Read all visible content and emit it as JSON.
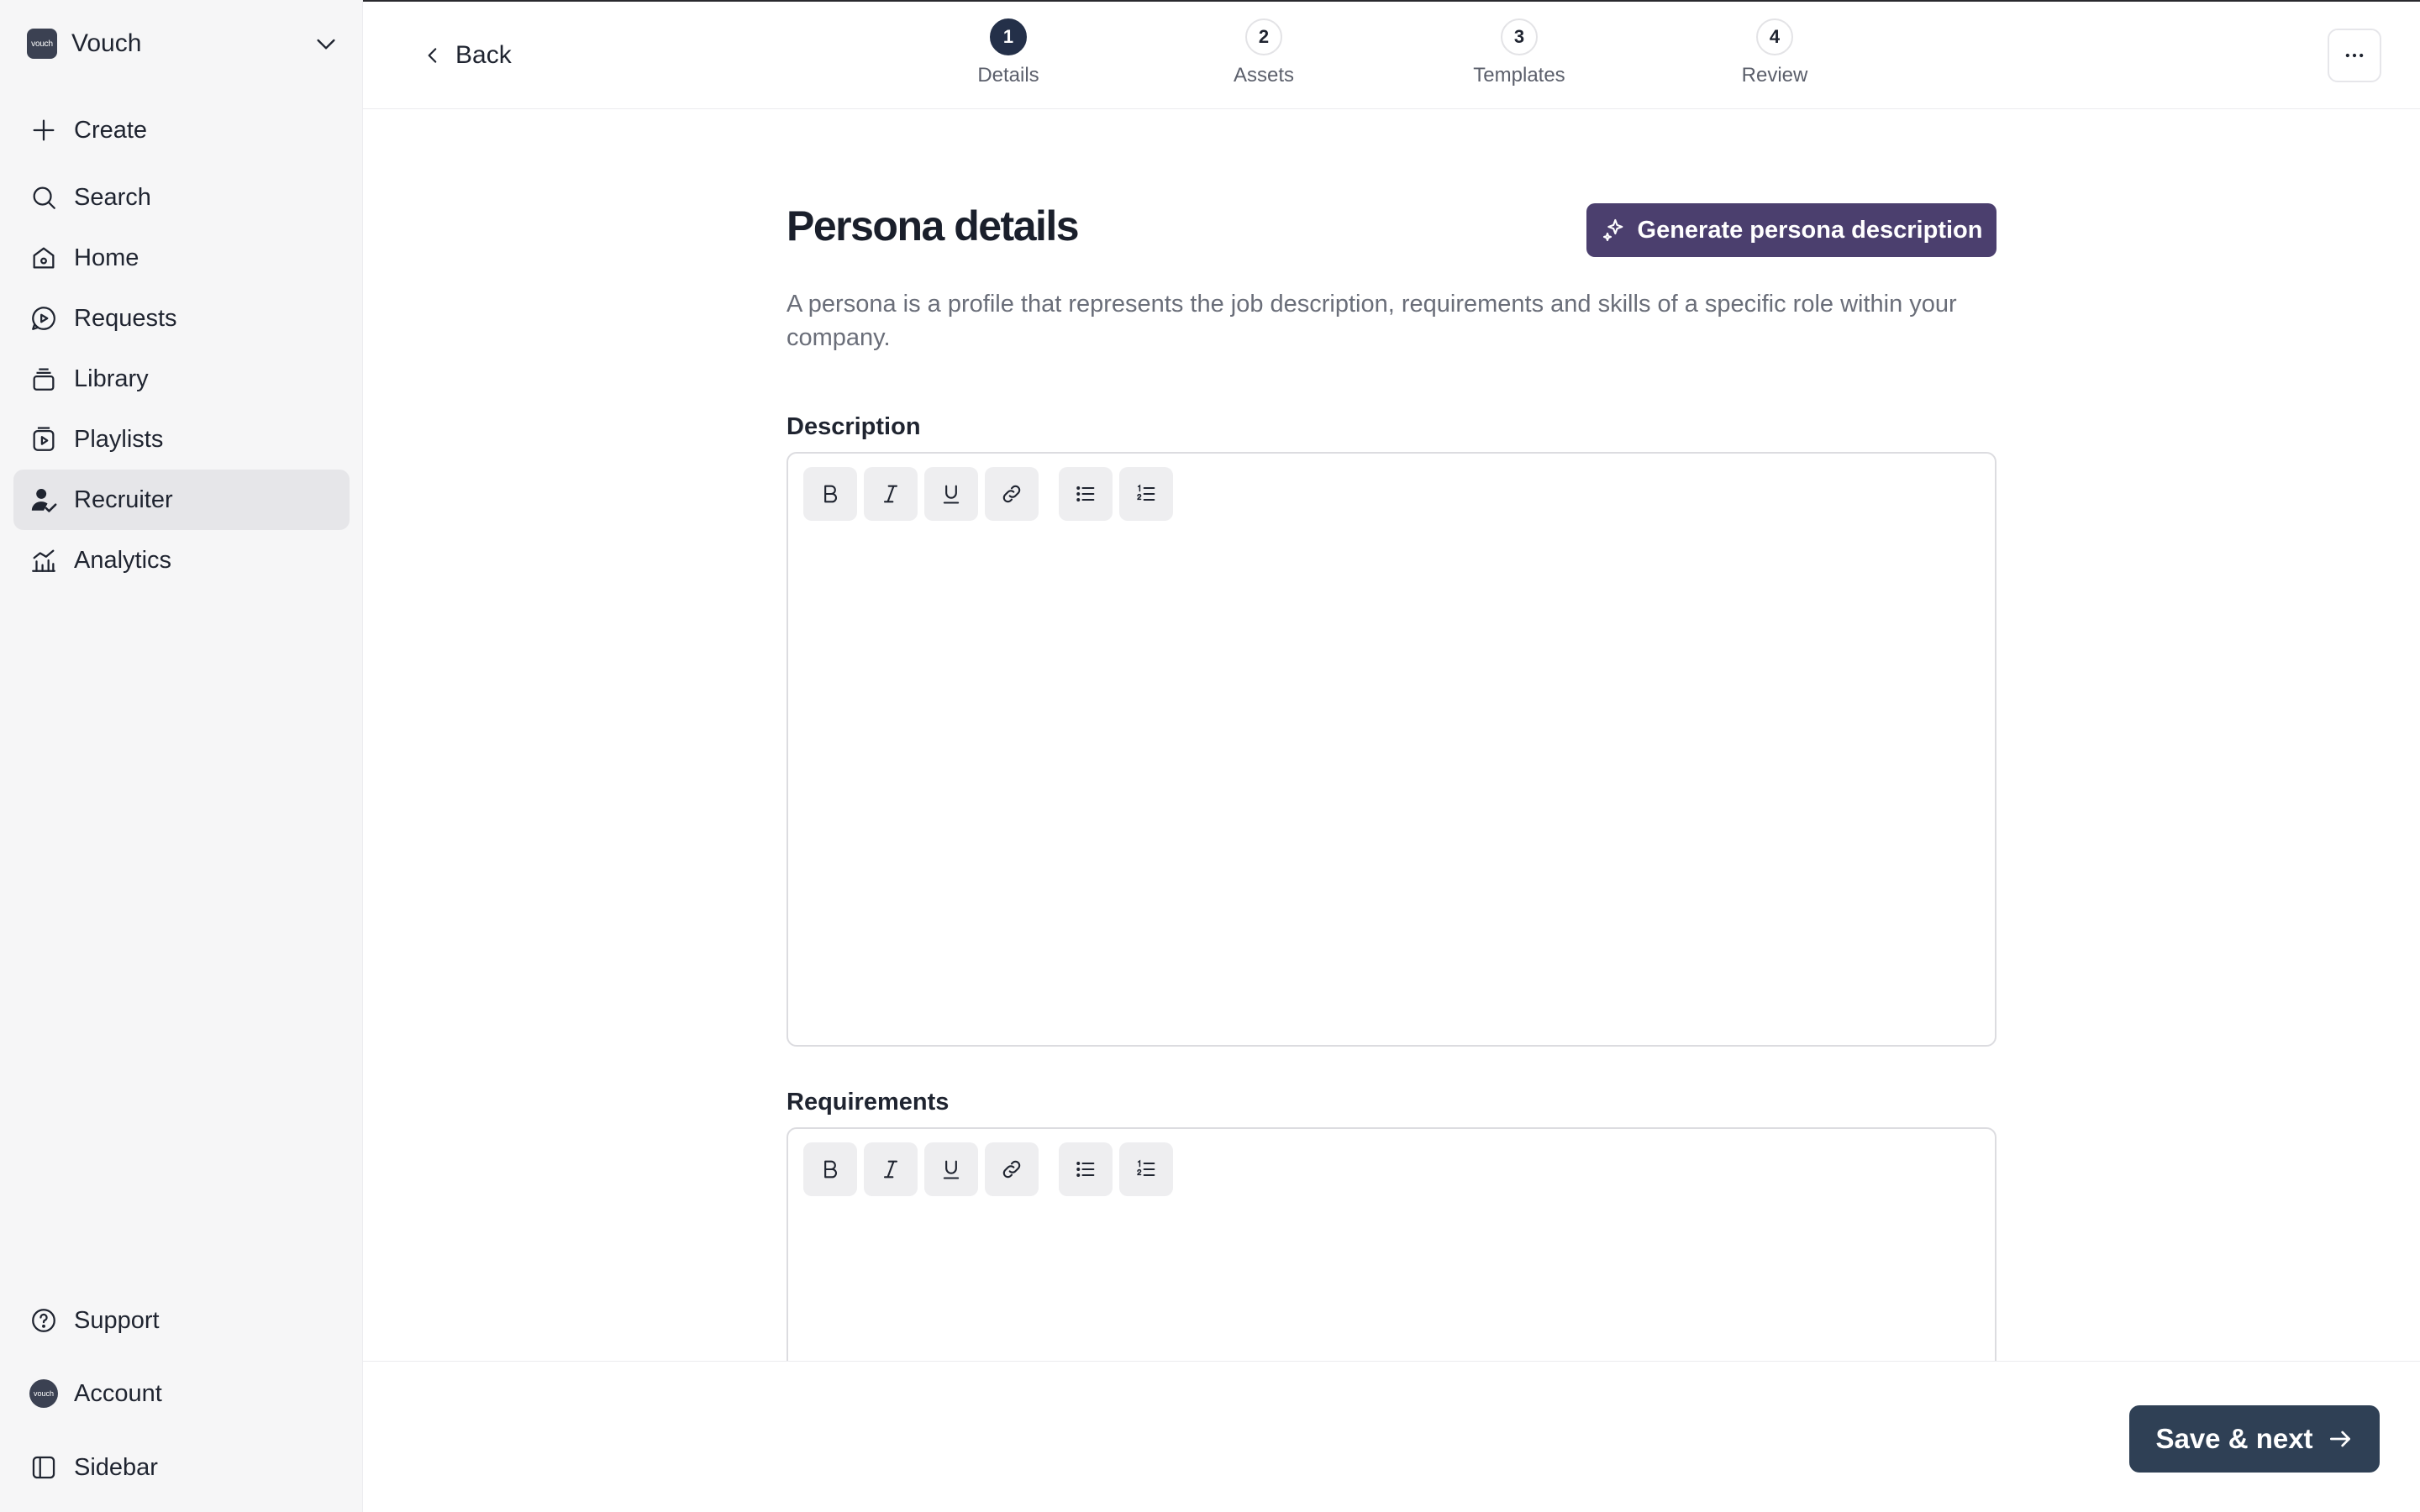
{
  "workspace": {
    "name": "Vouch",
    "logo_text": "vouch"
  },
  "sidebar": {
    "items": [
      {
        "label": "Create",
        "icon": "plus-icon"
      },
      {
        "label": "Search",
        "icon": "search-icon"
      },
      {
        "label": "Home",
        "icon": "home-icon"
      },
      {
        "label": "Requests",
        "icon": "requests-icon"
      },
      {
        "label": "Library",
        "icon": "library-icon"
      },
      {
        "label": "Playlists",
        "icon": "playlists-icon"
      },
      {
        "label": "Recruiter",
        "icon": "recruiter-icon",
        "active": true
      },
      {
        "label": "Analytics",
        "icon": "analytics-icon"
      }
    ],
    "bottom": [
      {
        "label": "Support",
        "icon": "help-icon"
      },
      {
        "label": "Account",
        "icon": "account-avatar"
      },
      {
        "label": "Sidebar",
        "icon": "sidebar-toggle-icon"
      }
    ]
  },
  "header": {
    "back_label": "Back",
    "steps": [
      {
        "number": "1",
        "label": "Details",
        "current": true
      },
      {
        "number": "2",
        "label": "Assets"
      },
      {
        "number": "3",
        "label": "Templates"
      },
      {
        "number": "4",
        "label": "Review"
      }
    ]
  },
  "main": {
    "title": "Persona details",
    "generate_label": "Generate persona description",
    "description": "A persona is a profile that represents the job description, requirements and skills of a specific role within your company.",
    "fields": [
      {
        "label": "Description",
        "value": ""
      },
      {
        "label": "Requirements",
        "value": ""
      }
    ],
    "toolbar_tools": [
      "bold",
      "italic",
      "underline",
      "link",
      "bulleted-list",
      "numbered-list"
    ]
  },
  "footer": {
    "save_label": "Save & next"
  },
  "colors": {
    "sidebar_bg": "#f6f6f7",
    "active_nav": "#e6e6e9",
    "generate_button": "#4b3f6e",
    "save_button": "#2f4055",
    "current_step": "#243049"
  }
}
